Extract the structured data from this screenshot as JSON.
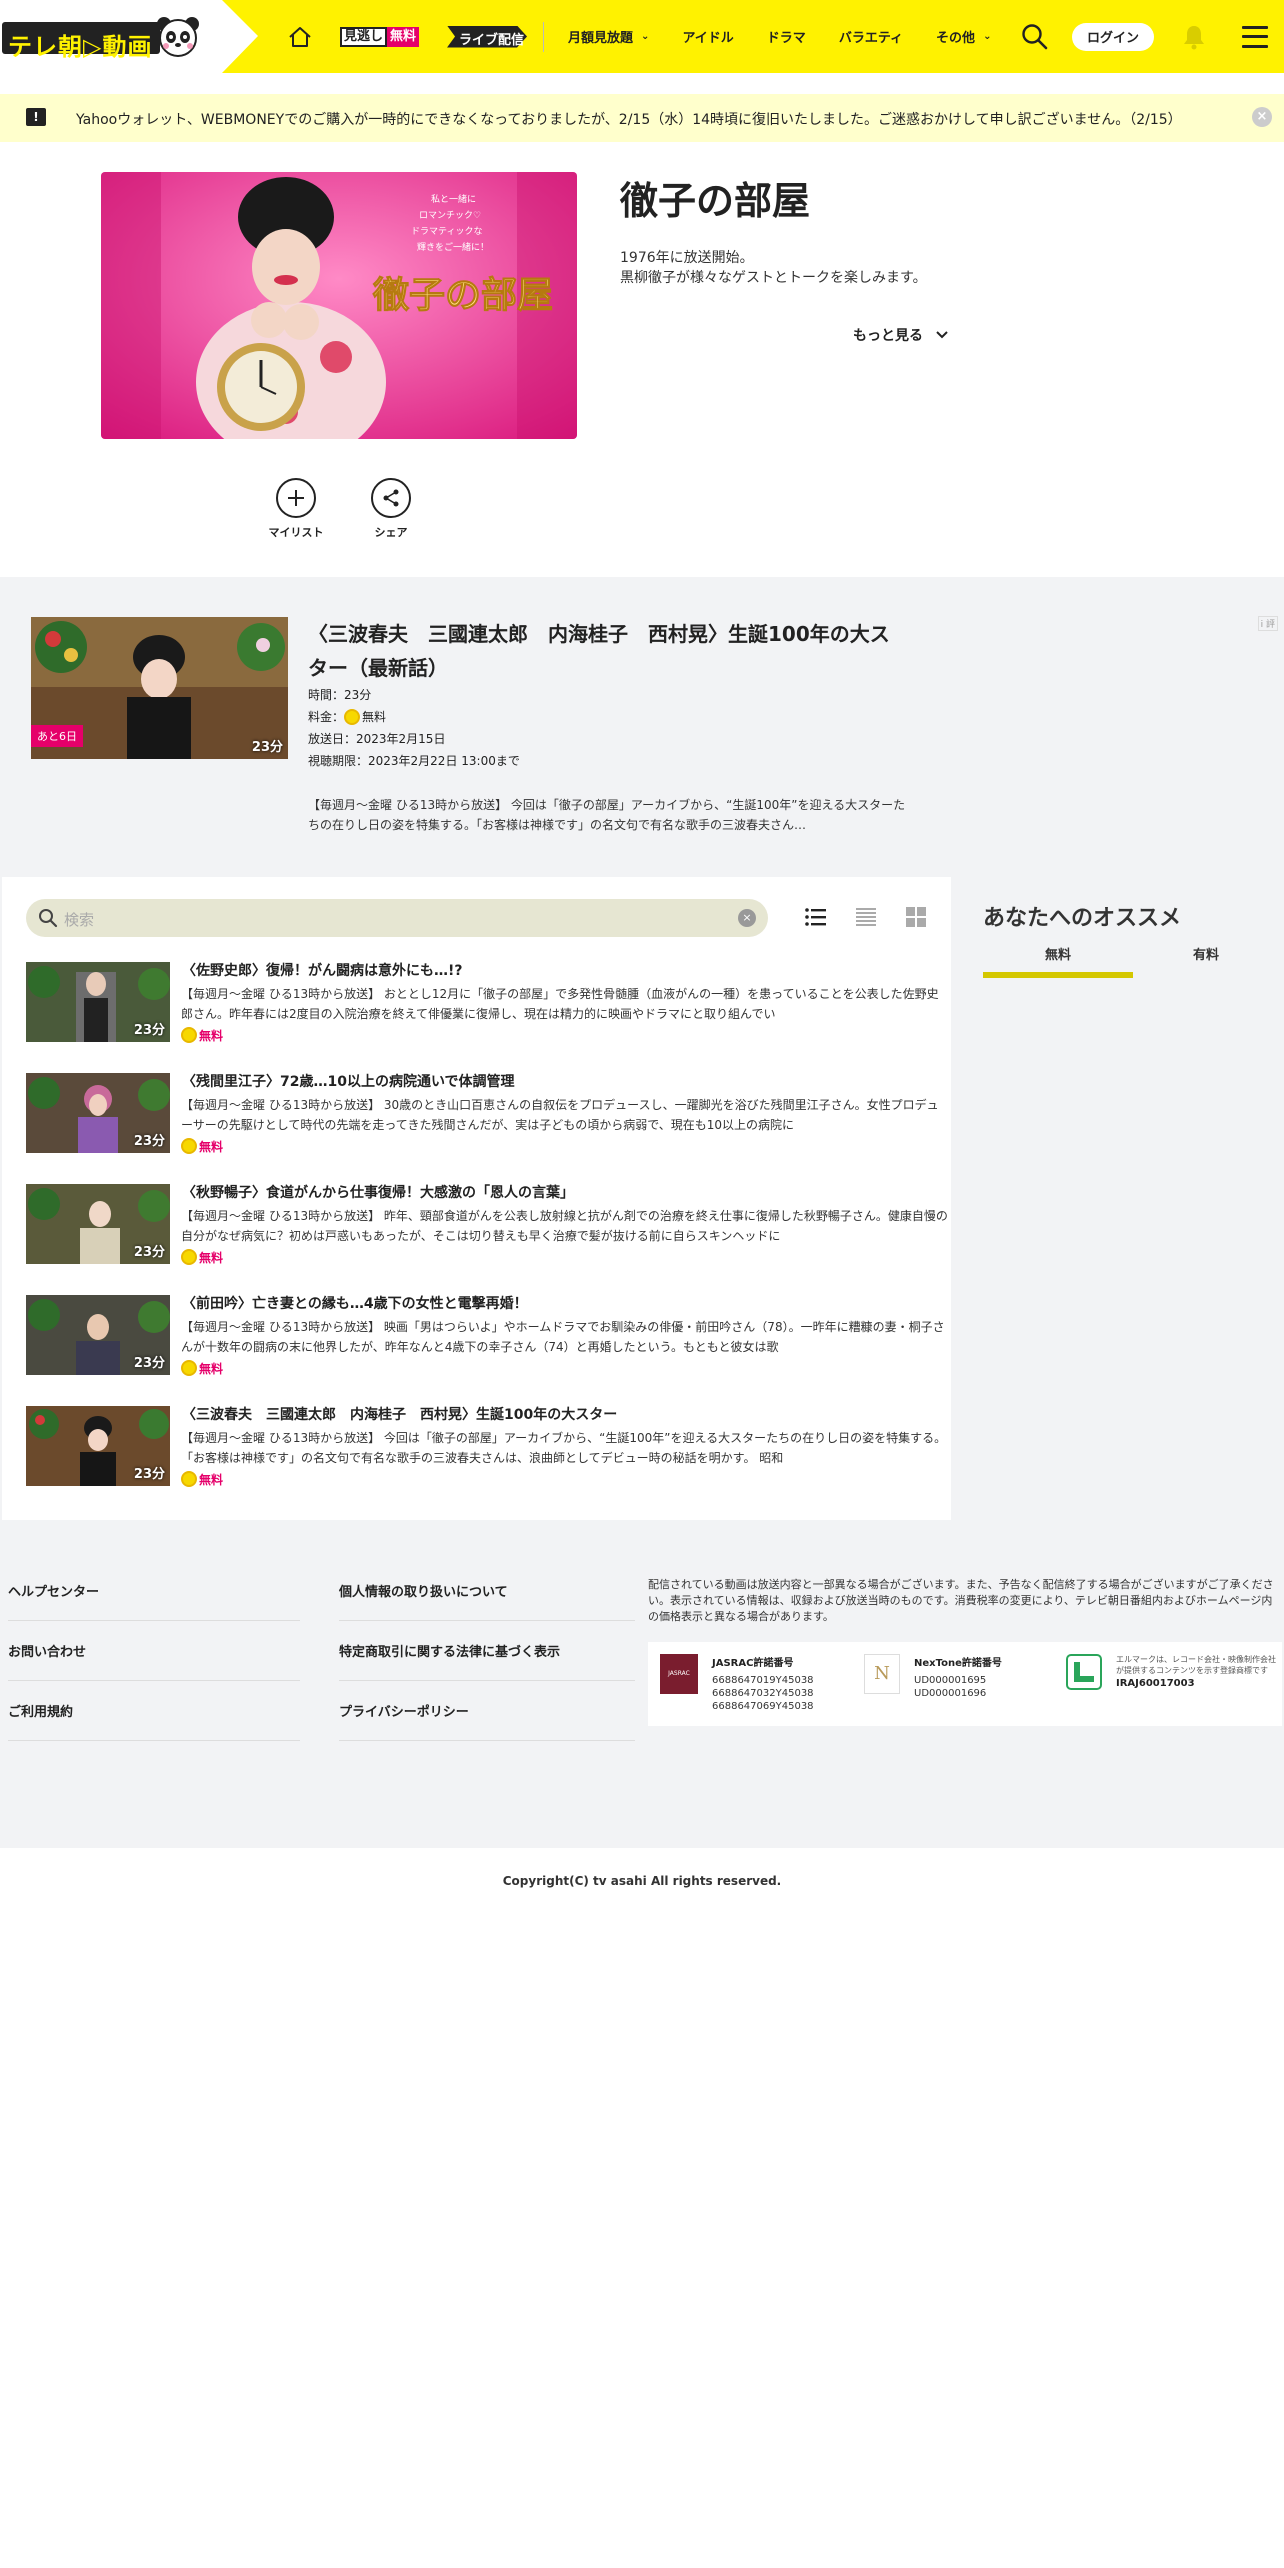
{
  "header": {
    "logo_text": "テレ朝▷動画",
    "mitoshi_left": "見逃し",
    "mitoshi_right": "無料",
    "live_label": "ライブ配信",
    "nav_items": [
      {
        "label": "月額見放題",
        "has_dropdown": true
      },
      {
        "label": "アイドル",
        "has_dropdown": false
      },
      {
        "label": "ドラマ",
        "has_dropdown": false
      },
      {
        "label": "バラエティ",
        "has_dropdown": false
      },
      {
        "label": "その他",
        "has_dropdown": true
      }
    ],
    "login_label": "ログイン",
    "accent_color": "#fff200"
  },
  "notice": {
    "text": "Yahooウォレット、WEBMONEYでのご購入が一時的にできなくなっておりましたが、2/15（水）14時頃に復旧いたしました。ご迷惑おかけして申し訳ございません。（2/15）",
    "icon_glyph": "!",
    "close_glyph": "×"
  },
  "program": {
    "title": "徹子の部屋",
    "desc_line1": "1976年に放送開始。",
    "desc_line2": "黒柳徹子が様々なゲストとトークを楽しみます。",
    "more_label": "もっと見る",
    "hero_caption": "徹子の部屋",
    "hero_tagline": "私と一緒に ロマンチック♡ ドラマティックな 輝きをご一緒に！",
    "actions": [
      {
        "label": "マイリスト",
        "icon": "plus-icon"
      },
      {
        "label": "シェア",
        "icon": "share-icon"
      }
    ]
  },
  "latest": {
    "title": "〈三波春夫　三國連太郎　内海桂子　西村晃〉生誕100年の大スター（最新話）",
    "remaining_tag": "あと6日",
    "duration": "23分",
    "time": "時間：23分",
    "price_label": "料金：",
    "price_value": "無料",
    "air_date": "放送日：2023年2月15日",
    "deadline": "視聴期限：2023年2月22日 13:00まで",
    "desc": "【毎週月～金曜 ひる13時から放送】 今回は「徹子の部屋」アーカイブから、“生誕100年”を迎える大スターたちの在りし日の姿を特集する。「お客様は神様です」の名文句で有名な歌手の三波春夫さん…",
    "ad_mark": "i 評"
  },
  "episodes": {
    "search_placeholder": "検索",
    "clear_glyph": "×",
    "free_label": "無料",
    "items": [
      {
        "title": "〈佐野史郎〉復帰！がん闘病は意外にも…!?",
        "desc": "【毎週月～金曜 ひる13時から放送】 おととし12月に「徹子の部屋」で多発性骨髄腫（血液がんの一種）を患っていることを公表した佐野史郎さん。昨年春には2度目の入院治療を終えて俳優業に復帰し、現在は精力的に映画やドラマにと取り組んでい",
        "duration": "23分"
      },
      {
        "title": "〈残間里江子〉72歳…10以上の病院通いで体調管理",
        "desc": "【毎週月～金曜 ひる13時から放送】 30歳のとき山口百恵さんの自叙伝をプロデュースし、一躍脚光を浴びた残間里江子さん。女性プロデューサーの先駆けとして時代の先端を走ってきた残間さんだが、実は子どもの頃から病弱で、現在も10以上の病院に",
        "duration": "23分"
      },
      {
        "title": "〈秋野暢子〉食道がんから仕事復帰！大感激の「恩人の言葉」",
        "desc": "【毎週月～金曜 ひる13時から放送】 昨年、頸部食道がんを公表し放射線と抗がん剤での治療を終え仕事に復帰した秋野暢子さん。健康自慢の自分がなぜ病気に？初めは戸惑いもあったが、そこは切り替えも早く治療で髪が抜ける前に自らスキンヘッドに",
        "duration": "23分"
      },
      {
        "title": "〈前田吟〉亡き妻との縁も…4歳下の女性と電撃再婚！",
        "desc": "【毎週月～金曜 ひる13時から放送】 映画「男はつらいよ」やホームドラマでお馴染みの俳優・前田吟さん（78）。一昨年に糟糠の妻・桐子さんが十数年の闘病の末に他界したが、昨年なんと4歳下の幸子さん（74）と再婚したという。もともと彼女は歌",
        "duration": "23分"
      },
      {
        "title": "〈三波春夫　三國連太郎　内海桂子　西村晃〉生誕100年の大スター",
        "desc": "【毎週月～金曜 ひる13時から放送】 今回は「徹子の部屋」アーカイブから、“生誕100年”を迎える大スターたちの在りし日の姿を特集する。「お客様は神様です」の名文句で有名な歌手の三波春夫さんは、浪曲師としてデビュー時の秘話を明かす。 昭和",
        "duration": "23分"
      }
    ]
  },
  "recommend": {
    "title": "あなたへのオススメ",
    "tabs": [
      "無料",
      "有料"
    ],
    "active_tab": "無料"
  },
  "footer": {
    "col1": [
      "ヘルプセンター",
      "お問い合わせ",
      "ご利用規約"
    ],
    "col2": [
      "個人情報の取り扱いについて",
      "特定商取引に関する法律に基づく表示",
      "プライバシーポリシー"
    ],
    "note": "配信されている動画は放送内容と一部異なる場合がございます。また、予告なく配信終了する場合がございますがご了承ください。表示されている情報は、収録および放送当時のものです。消費税率の変更により、テレビ朝日番組内およびホームページ内の価格表示と異なる場合があります。",
    "licenses": [
      {
        "title": "JASRAC許諾番号",
        "numbers": [
          "6688647019Y45038",
          "6688647032Y45038",
          "6688647069Y45038"
        ]
      },
      {
        "title": "NexTone許諾番号",
        "numbers": [
          "UD000001695",
          "UD000001696"
        ]
      },
      {
        "title": "エルマークは、レコード会社・映像制作会社が提供するコンテンツを示す登録商標です",
        "numbers": [
          "IRAJ60017003"
        ]
      }
    ],
    "jasrac_logo_text": "JASRAC",
    "nextone_logo_text": "N",
    "copyright": "Copyright(C) tv asahi All rights reserved."
  }
}
